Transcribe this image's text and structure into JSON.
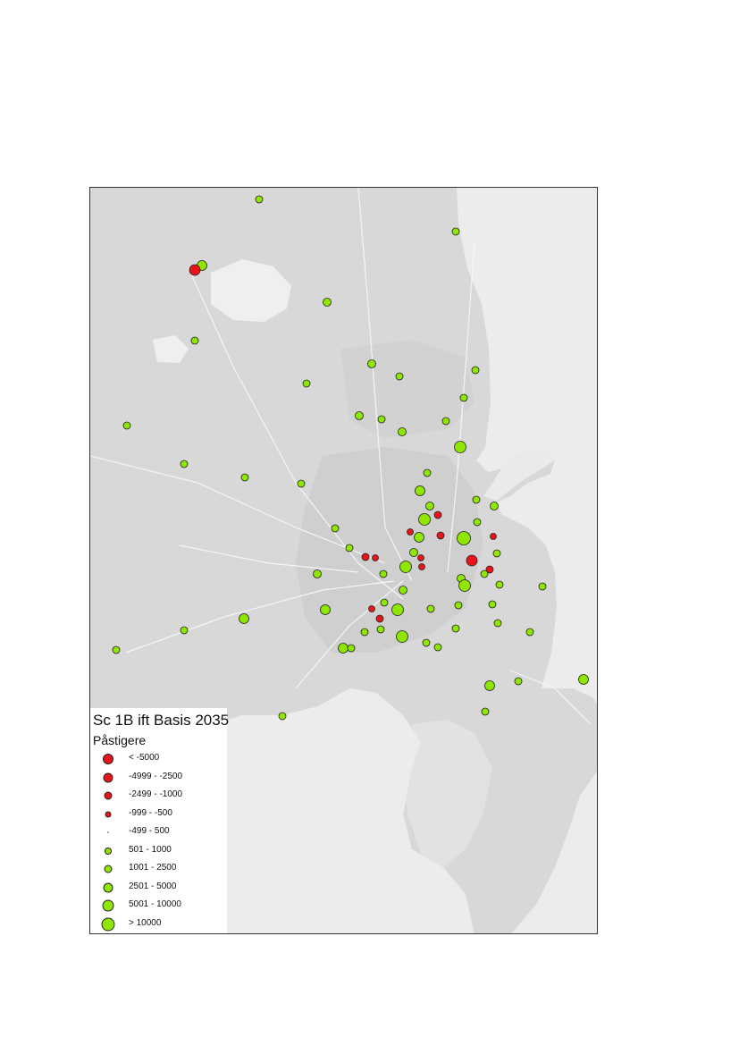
{
  "map": {
    "legend": {
      "title": "Sc 1B ift Basis 2035",
      "subtitle": "Påstigere",
      "classes": [
        {
          "label": "< -5000",
          "color": "#e8141a",
          "size": 6
        },
        {
          "label": "-4999 - -2500",
          "color": "#e8141a",
          "size": 5
        },
        {
          "label": "-2499 - -1000",
          "color": "#e8141a",
          "size": 4
        },
        {
          "label": "-999 - -500",
          "color": "#e8141a",
          "size": 3
        },
        {
          "label": "-499 - 500",
          "color": "#888888",
          "size": 0
        },
        {
          "label": "501 - 1000",
          "color": "#8fe600",
          "size": 3
        },
        {
          "label": "1001 - 2500",
          "color": "#8fe600",
          "size": 4
        },
        {
          "label": "2501 - 5000",
          "color": "#8fe600",
          "size": 5
        },
        {
          "label": "5001 - 10000",
          "color": "#8fe600",
          "size": 6
        },
        {
          "label": "> 10000",
          "color": "#8fe600",
          "size": 7
        }
      ]
    },
    "colors": {
      "land": "#d9d9d9",
      "sea": "#ececec",
      "water": "#efefef",
      "negative": "#e8141a",
      "positive": "#8fe600"
    }
  }
}
